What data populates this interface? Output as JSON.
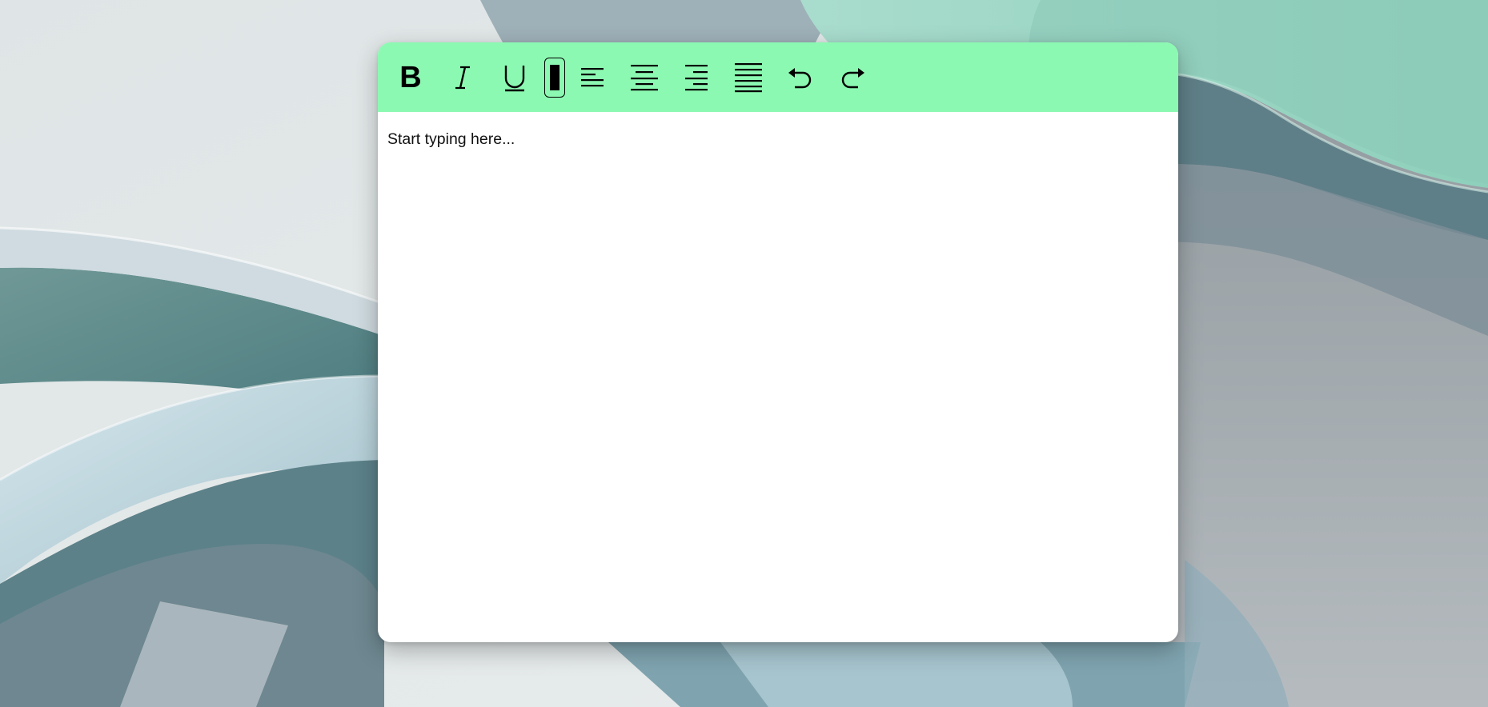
{
  "editor": {
    "content_placeholder": "Start typing here...",
    "toolbar_color": "#8cf9b2",
    "tools": [
      {
        "name": "bold",
        "icon": "bold-icon"
      },
      {
        "name": "italic",
        "icon": "italic-icon"
      },
      {
        "name": "underline",
        "icon": "underline-icon"
      },
      {
        "name": "highlight",
        "icon": "highlight-icon",
        "active": true
      },
      {
        "name": "align-left",
        "icon": "align-left-icon"
      },
      {
        "name": "align-center",
        "icon": "align-center-icon"
      },
      {
        "name": "align-right",
        "icon": "align-right-icon"
      },
      {
        "name": "justify",
        "icon": "align-justify-icon"
      },
      {
        "name": "undo",
        "icon": "undo-icon"
      },
      {
        "name": "redo",
        "icon": "redo-icon"
      }
    ]
  }
}
